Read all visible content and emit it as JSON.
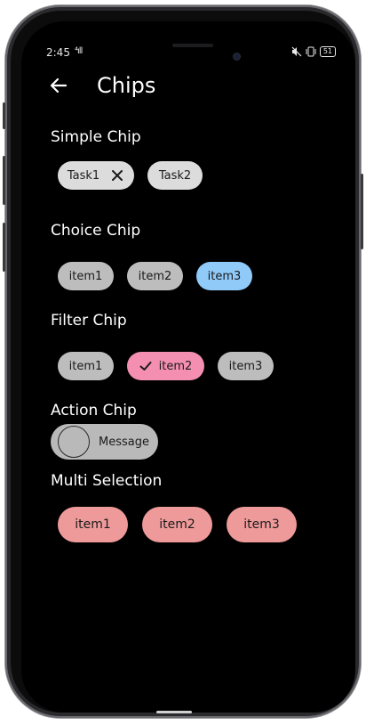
{
  "status_bar": {
    "time": "2:45",
    "signal": "⁴ıll",
    "battery": "51"
  },
  "app_bar": {
    "title": "Chips",
    "back_icon": "arrow-left-icon"
  },
  "sections": {
    "simple": {
      "label": "Simple Chip",
      "chips": [
        "Task1",
        "Task2"
      ]
    },
    "choice": {
      "label": "Choice Chip",
      "chips": [
        "item1",
        "item2",
        "item3"
      ],
      "selected": "item3"
    },
    "filter": {
      "label": "Filter Chip",
      "chips": [
        "item1",
        "item2",
        "item3"
      ],
      "selected": "item2"
    },
    "action": {
      "label": "Action Chip",
      "chip": "Message"
    },
    "multi": {
      "label": "Multi Selection",
      "chips": [
        "item1",
        "item2",
        "item3"
      ]
    }
  },
  "colors": {
    "background": "#000000",
    "simple_chip": "#dcdcdc",
    "unselected_chip": "#bdbdbd",
    "choice_selected": "#90caf9",
    "filter_selected": "#f48fb1",
    "multi_chip": "#ef9a9a"
  }
}
